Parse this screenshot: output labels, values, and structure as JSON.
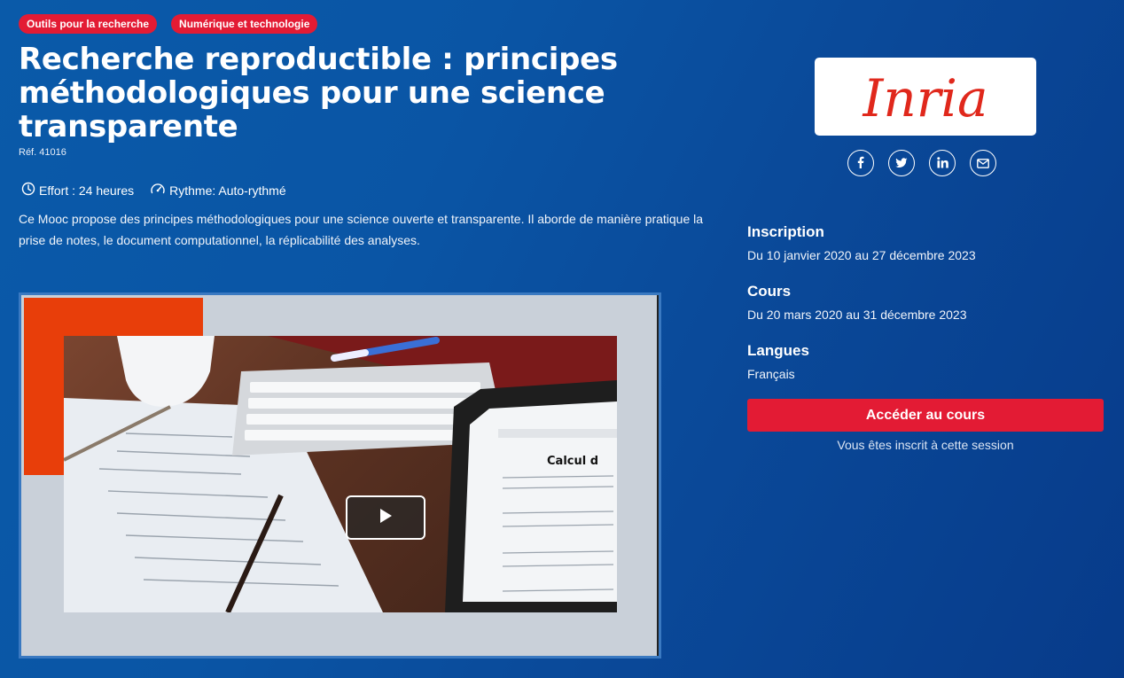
{
  "tags": [
    "Outils pour la recherche",
    "Numérique et technologie"
  ],
  "course": {
    "title": "Recherche reproductible : principes méthodologiques pour une science transparente",
    "ref": "Réf. 41016",
    "effort": "Effort : 24 heures",
    "rhythm": "Rythme: Auto-rythmé",
    "description": "Ce Mooc propose des principes méthodologiques pour une science ouverte et transparente. Il aborde de manière pratique la prise de notes, le document computationnel, la réplicabilité des analyses."
  },
  "video": {
    "play_icon": "play-icon",
    "screen_text": "Calcul d",
    "keyboard_colors": {
      "desk": "#5c3222",
      "paper": "#e9edf2"
    }
  },
  "sidebar": {
    "logo_text": "Inria",
    "logo_color": "#e0281c",
    "social": [
      "facebook-icon",
      "twitter-icon",
      "linkedin-icon",
      "mail-icon"
    ],
    "inscription": {
      "label": "Inscription",
      "value": "Du 10 janvier 2020 au 27 décembre 2023"
    },
    "cours": {
      "label": "Cours",
      "value": "Du 20 mars 2020 au 31 décembre 2023"
    },
    "langues": {
      "label": "Langues",
      "value": "Français"
    },
    "cta_label": "Accéder au cours",
    "enrolled_text": "Vous êtes inscrit à cette session"
  },
  "colors": {
    "accent": "#e31b34",
    "background": "#0a55a5",
    "video_red": "#e83e0a"
  }
}
